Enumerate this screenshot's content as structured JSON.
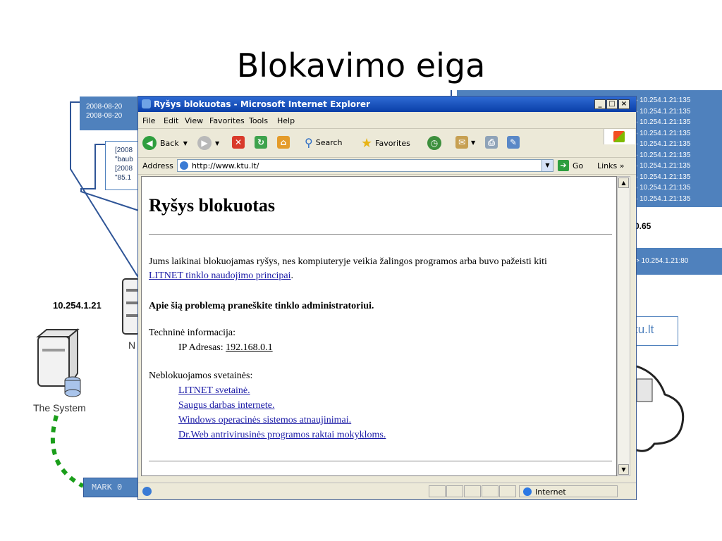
{
  "slide": {
    "title": "Blokavimo eiga",
    "ip_left": "10.254.1.21",
    "system_label": "The System",
    "n_fragment": "N",
    "bold_fragment": "0.65",
    "ktu_fragment": "tu.lt",
    "mark_label": "MARK 0",
    "log_topleft": [
      "2008-08-20",
      "2008-08-20"
    ],
    "log_midleft": [
      "[2008",
      "\"baub",
      "[2008",
      "\"85.1"
    ],
    "log_right": [
      "10.254.1.21:135",
      "10.254.1.21:135",
      "10.254.1.21:135",
      "10.254.1.21:135",
      "10.254.1.21:135",
      "10.254.1.21:135",
      "10.254.1.21:135",
      "10.254.1.21:135",
      "10.254.1.21:135",
      "10.254.1.21:135"
    ],
    "log_right_single": "> 10.254.1.21:80",
    "colors": {
      "accent_blue": "#4f81bd",
      "dashed_green": "#1a9e1a"
    }
  },
  "browser": {
    "title": "Ryšys blokuotas - Microsoft Internet Explorer",
    "menu": [
      "File",
      "Edit",
      "View",
      "Favorites",
      "Tools",
      "Help"
    ],
    "toolbar": {
      "back": "Back",
      "search": "Search",
      "favorites": "Favorites"
    },
    "address_label": "Address",
    "address_value": "http://www.ktu.lt/",
    "go_label": "Go",
    "links_label": "Links",
    "status_zone": "Internet"
  },
  "page": {
    "heading": "Ryšys blokuotas",
    "paragraph1": "Jums laikinai blokuojamas ryšys, nes kompiuteryje veikia žalingos programos arba buvo pažeisti kiti",
    "paragraph1_link": "LITNET tinklo naudojimo principai",
    "bold_line": "Apie šią problemą praneškite tinklo administratoriui.",
    "tech_label": "Techninė informacija:",
    "ip_label": "IP Adresas:",
    "ip_value": "192.168.0.1",
    "unblocked_label": "Neblokuojamos svetainės:",
    "unblocked_links": [
      "LITNET svetainė.",
      "Saugus darbas internete.",
      "Windows operacinės sistemos atnaujinimai.",
      "Dr.Web antrivirusinės programos raktai mokykloms."
    ]
  }
}
